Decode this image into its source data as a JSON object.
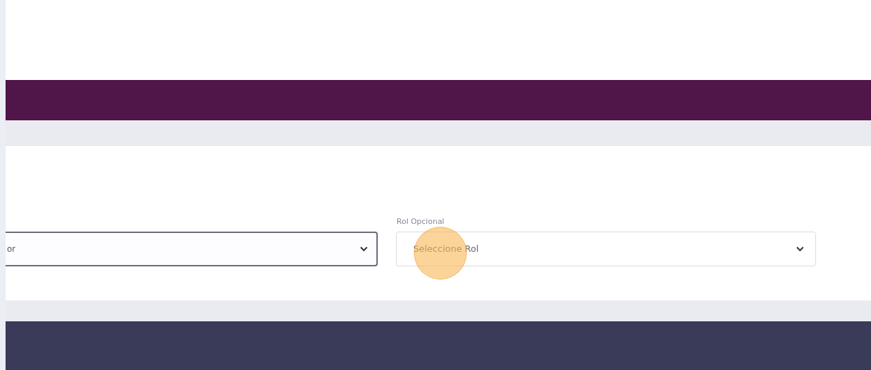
{
  "form": {
    "fields": [
      {
        "value": "or",
        "focused": true
      },
      {
        "label": "Rol Opcional",
        "value": "Seleccione Rol",
        "focused": false
      }
    ]
  },
  "click_highlight": true
}
